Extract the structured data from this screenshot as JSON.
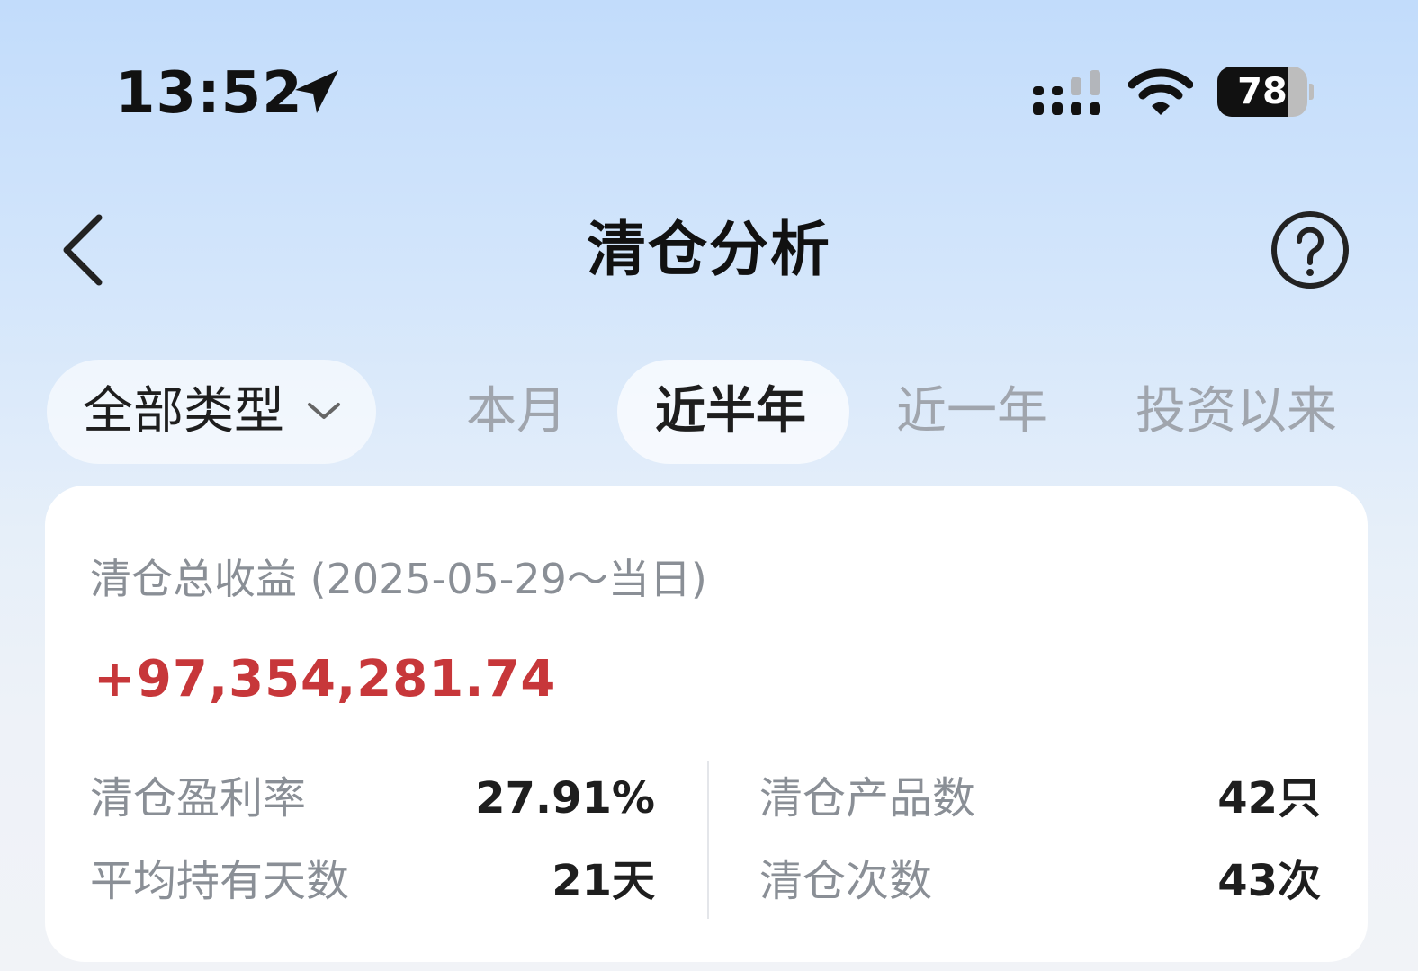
{
  "status_bar": {
    "time": "13:52",
    "battery": "78",
    "battery_level": 0.78,
    "icons": [
      "location-arrow-icon",
      "cellular-signal-icon",
      "wifi-icon",
      "battery-icon"
    ]
  },
  "nav": {
    "title": "清仓分析",
    "icons": [
      "chevron-left-icon",
      "question-circle-icon"
    ]
  },
  "filters": {
    "type_selector": "全部类型",
    "ranges": [
      "本月",
      "近半年",
      "近一年",
      "投资以来"
    ],
    "active_range": "近半年"
  },
  "summary": {
    "total_label": "清仓总收益 (2025-05-29～当日)",
    "total_value": "+97,354,281.74",
    "stats": [
      {
        "label": "清仓盈利率",
        "value": "27.91%"
      },
      {
        "label": "平均持有天数",
        "value": "21天"
      },
      {
        "label": "清仓产品数",
        "value": "42只"
      },
      {
        "label": "清仓次数",
        "value": "43次"
      }
    ]
  },
  "colors": {
    "profit": "#c7373a",
    "muted_text": "#8a8f96",
    "primary_text": "#1e1e1e"
  }
}
